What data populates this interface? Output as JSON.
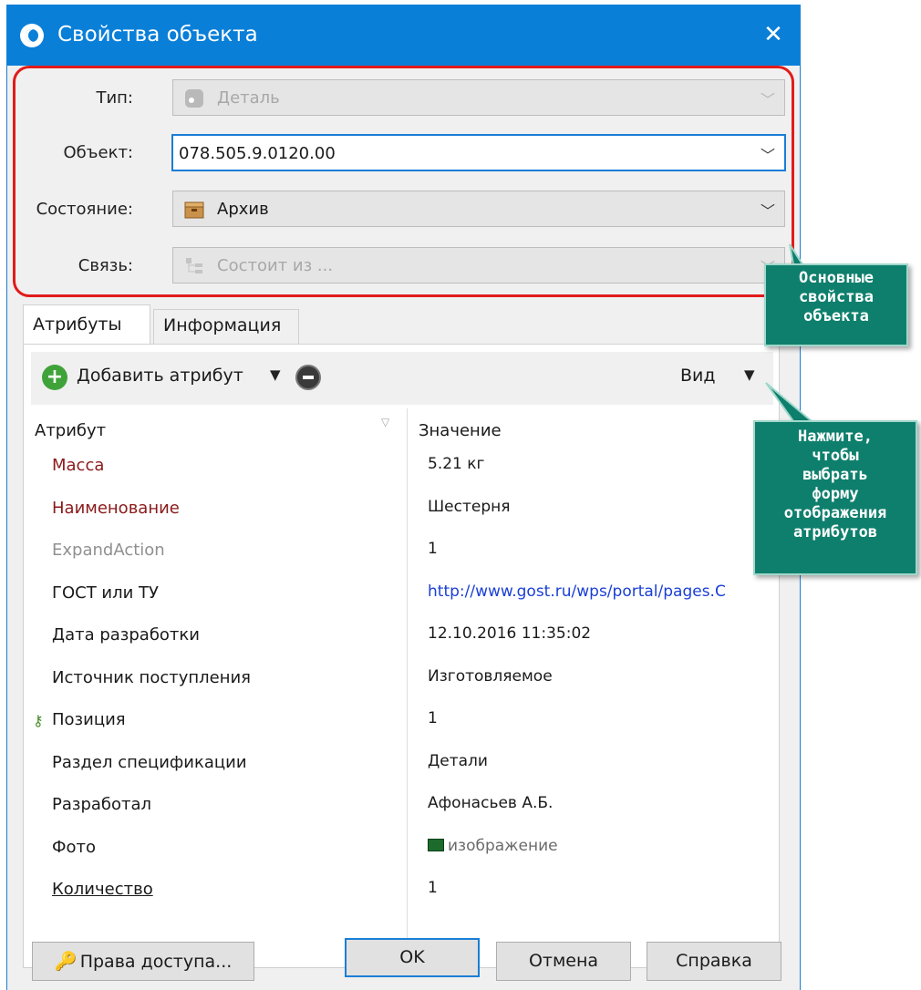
{
  "window": {
    "title": "Свойства объекта",
    "close_glyph": "✕"
  },
  "properties": {
    "type": {
      "label": "Тип:",
      "value": "Деталь"
    },
    "object": {
      "label": "Объект:",
      "value": "078.505.9.0120.00"
    },
    "state": {
      "label": "Состояние:",
      "value": "Архив"
    },
    "link": {
      "label": "Связь:",
      "value": "Состоит из ..."
    },
    "chevron": "﹀"
  },
  "tabs": [
    {
      "label": "Атрибуты"
    },
    {
      "label": "Информация"
    }
  ],
  "toolbar": {
    "add_label": "Добавить атрибут",
    "add_plus": "+",
    "dropdown_glyph": "▼",
    "view_label": "Вид"
  },
  "grid": {
    "col_attribute": "Атрибут",
    "col_value": "Значение",
    "filter_glyph": "▽",
    "rows": [
      {
        "name": "Масса",
        "value": "5.21 кг",
        "name_color": "#8b1a1a"
      },
      {
        "name": "Наименование",
        "value": "Шестерня",
        "name_color": "#8b1a1a"
      },
      {
        "name": "ExpandAction",
        "value": "1",
        "name_color": "#909090"
      },
      {
        "name": "ГОСТ или ТУ",
        "value": "http://www.gost.ru/wps/portal/pages.C",
        "name_color": "#1a1a1a",
        "value_color": "#1a3fd6"
      },
      {
        "name": "Дата разработки",
        "value": "12.10.2016 11:35:02",
        "name_color": "#1a1a1a"
      },
      {
        "name": "Источник поступления",
        "value": "Изготовляемое",
        "name_color": "#1a1a1a"
      },
      {
        "name": "Позиция",
        "value": "1",
        "name_color": "#1a1a1a",
        "key_glyph": "⚷"
      },
      {
        "name": "Раздел спецификации",
        "value": "Детали",
        "name_color": "#1a1a1a"
      },
      {
        "name": "Разработал",
        "value": "Афонасьев А.Б.",
        "name_color": "#1a1a1a"
      },
      {
        "name": "Фото",
        "value": "изображение",
        "name_color": "#1a1a1a",
        "value_color": "#6b6b6b"
      },
      {
        "name": "Количество",
        "value": "1",
        "name_color": "#1a1a1a"
      }
    ]
  },
  "buttons": {
    "access": "Права доступа...",
    "ok": "OK",
    "cancel": "Отмена",
    "help": "Справка",
    "lock_glyph": "🔑"
  },
  "callouts": {
    "main_props": "Основные\nсвойства\nобъекта",
    "view_hint": "Нажмите,\nчтобы\nвыбрать\nформу\nотображения\nатрибутов"
  },
  "colors": {
    "titlebar": "#0a7fd8",
    "highlight_border": "#e11b1b",
    "callout_bg": "#0f7f6d"
  }
}
